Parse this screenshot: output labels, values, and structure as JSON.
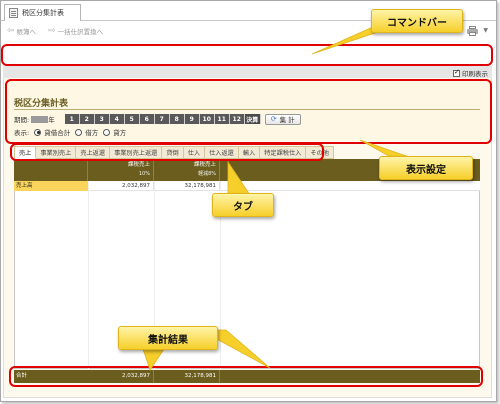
{
  "window": {
    "doc_tab_label": "税区分集計表"
  },
  "command_bar": {
    "items": [
      {
        "label": "帳簿へ"
      },
      {
        "label": "一括仕訳置換へ"
      }
    ]
  },
  "options": {
    "wrap_display_label": "印刷表示",
    "wrap_display_checked": true
  },
  "page": {
    "title": "税区分集計表"
  },
  "period": {
    "label": "期間:",
    "year_suffix": "年",
    "months": [
      "1",
      "2",
      "3",
      "4",
      "5",
      "6",
      "7",
      "8",
      "9",
      "10",
      "11",
      "12"
    ],
    "final_label": "決算",
    "calc_button_label": "集 計",
    "calc_icon": "refresh-icon"
  },
  "display": {
    "label": "表示:",
    "options": [
      {
        "label": "貸借合計",
        "selected": true
      },
      {
        "label": "借方",
        "selected": false
      },
      {
        "label": "貸方",
        "selected": false
      }
    ]
  },
  "tabs": [
    {
      "label": "売上",
      "active": true
    },
    {
      "label": "事業別売上",
      "active": false
    },
    {
      "label": "売上返還",
      "active": false
    },
    {
      "label": "事業別売上返還",
      "active": false
    },
    {
      "label": "貸倒",
      "active": false
    },
    {
      "label": "仕入",
      "active": false
    },
    {
      "label": "仕入返還",
      "active": false
    },
    {
      "label": "輸入",
      "active": false
    },
    {
      "label": "特定課税仕入",
      "active": false
    },
    {
      "label": "その他",
      "active": false
    }
  ],
  "grid": {
    "columns": [
      {
        "label": "",
        "sub": ""
      },
      {
        "label": "課税売上",
        "sub": "10%"
      },
      {
        "label": "課税売上",
        "sub": "軽減8%"
      }
    ],
    "rows": [
      {
        "label": "売上高",
        "values": [
          "2,032,897",
          "32,178,981"
        ]
      }
    ],
    "total": {
      "label": "合計",
      "values": [
        "2,032,897",
        "32,178,981"
      ]
    }
  },
  "callouts": {
    "command_bar": "コマンドバー",
    "display_settings": "表示設定",
    "tabs": "タブ",
    "results": "集計結果"
  },
  "colors": {
    "annotation_red": "#e00000",
    "header_olive": "#6a5d1d",
    "callout_yellow": "#f6cf2a",
    "selected_cell": "#fbd45c"
  }
}
